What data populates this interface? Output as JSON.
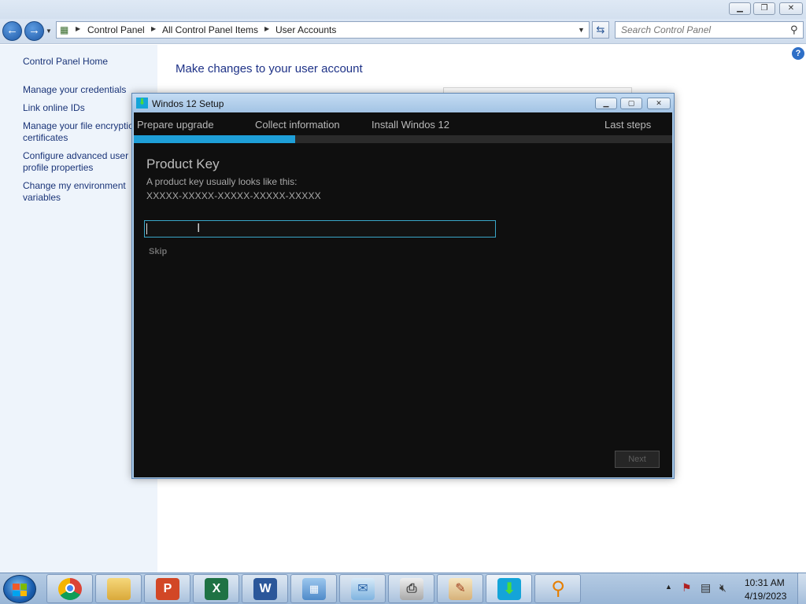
{
  "explorer": {
    "address": {
      "crumbs": [
        "Control Panel",
        "All Control Panel Items",
        "User Accounts"
      ]
    },
    "search": {
      "placeholder": "Search Control Panel"
    },
    "left_pane": {
      "home": "Control Panel Home",
      "links": [
        "Manage your credentials",
        "Link online IDs",
        "Manage your file encryption certificates",
        "Configure advanced user profile properties",
        "Change my environment variables"
      ],
      "link_lines": [
        [
          "Manage your credentials"
        ],
        [
          "Link online IDs"
        ],
        [
          "Manage your file encryptio",
          "certificates"
        ],
        [
          "Configure advanced user",
          "profile properties"
        ],
        [
          "Change my environment",
          "variables"
        ]
      ]
    },
    "main": {
      "title": "Make changes to your user account"
    }
  },
  "setup": {
    "title": "Windos 12 Setup",
    "steps": [
      "Prepare upgrade",
      "Collect information",
      "Install Windos 12",
      "Last steps"
    ],
    "progress": 0.3,
    "product_key": {
      "title": "Product Key",
      "description": "A product key usually looks like this:",
      "example": "XXXXX-XXXXX-XXXXX-XXXXX-XXXXX",
      "value": ""
    },
    "skip_label": "Skip",
    "next_label": "Next"
  },
  "taskbar": {
    "apps": [
      "chrome-icon",
      "file-explorer-icon",
      "powerpoint-icon",
      "excel-icon",
      "word-icon",
      "control-panel-icon",
      "mail-icon",
      "printer-icon",
      "paint-icon",
      "setup-download-icon",
      "search-magnifier-icon"
    ],
    "clock": {
      "time": "10:31 AM",
      "date": "4/19/2023"
    }
  },
  "colors": {
    "accent": "#1e9fd8",
    "link": "#1a3478",
    "dialog_bg": "#0f0f0f"
  }
}
